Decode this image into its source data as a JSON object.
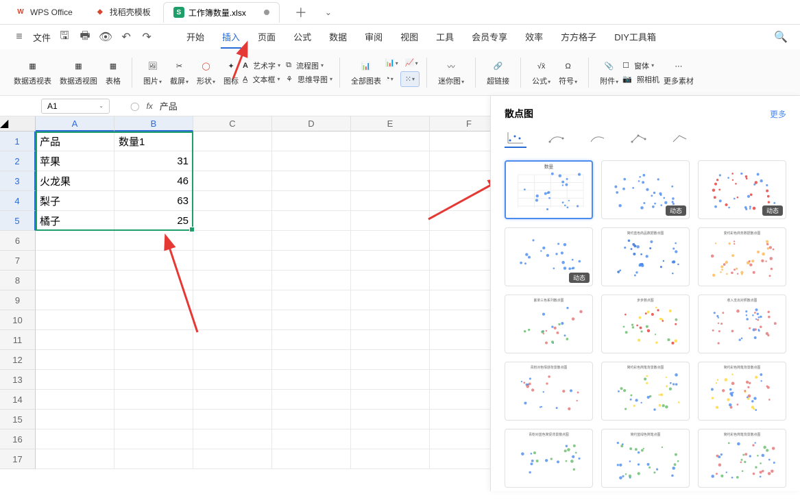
{
  "title_bar": {
    "app_tab": "WPS Office",
    "template_tab": "找稻壳模板",
    "file_tab": "工作簿数量.xlsx",
    "file_badge": "S"
  },
  "menu": {
    "file_label": "文件",
    "ribbon_tabs": [
      "开始",
      "插入",
      "页面",
      "公式",
      "数据",
      "审阅",
      "视图",
      "工具",
      "会员专享",
      "效率",
      "方方格子",
      "DIY工具箱"
    ]
  },
  "ribbon": {
    "pivot_table": "数据透视表",
    "pivot_chart": "数据透视图",
    "table": "表格",
    "picture": "图片",
    "screenshot": "截屏",
    "shapes": "形状",
    "icons": "图标",
    "wordart": "艺术字",
    "textbox": "文本框",
    "flowchart": "流程图",
    "mindmap": "思维导图",
    "all_charts": "全部图表",
    "sparkline": "迷你图",
    "hyperlink": "超链接",
    "formula": "公式",
    "symbol": "符号",
    "attachment": "附件",
    "camera": "照相机",
    "window": "窗体",
    "more": "更多素材"
  },
  "formula_bar": {
    "name_box": "A1",
    "fx": "fx",
    "value": "产品"
  },
  "sheet": {
    "columns": [
      "A",
      "B",
      "C",
      "D",
      "E",
      "F"
    ],
    "row_count": 17,
    "data": [
      {
        "A": "产品",
        "B": "数量1"
      },
      {
        "A": "苹果",
        "B": "31"
      },
      {
        "A": "火龙果",
        "B": "46"
      },
      {
        "A": "梨子",
        "B": "63"
      },
      {
        "A": "橘子",
        "B": "25"
      }
    ]
  },
  "chart_panel": {
    "title": "散点图",
    "more": "更多",
    "badge_dynamic": "动态",
    "thumb_titles": [
      "数量",
      "",
      "",
      "",
      "简约蓝色商品数据散点图",
      "变约彩色商务数据散点图",
      "紫单三色系列散点图",
      "步步数点图",
      "收入支出对照散点图",
      "青粉对色情感背景散点图",
      "简约彩色简笔背景散点图",
      "简约彩色简笔背景散点图",
      "青粉对蓝色简促背景散点图",
      "简约蓝绿色简笔点图",
      "简约彩色简笔背景散点图"
    ]
  },
  "chart_data": {
    "type": "scatter",
    "x_field": "产品",
    "y_field": "数量1",
    "categories": [
      "苹果",
      "火龙果",
      "梨子",
      "橘子"
    ],
    "values": [
      31,
      46,
      63,
      25
    ]
  }
}
